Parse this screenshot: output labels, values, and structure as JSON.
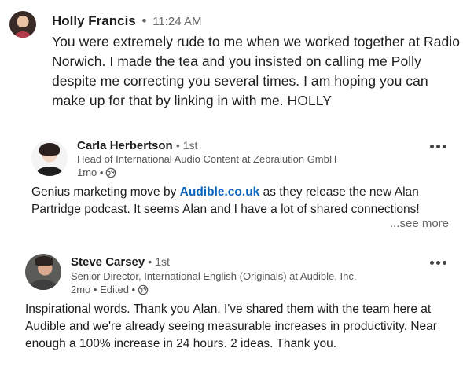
{
  "message": {
    "author": "Holly Francis",
    "separator": "•",
    "time": "11:24 AM",
    "body": "You were extremely rude to me when we worked together at Radio Norwich. I made the tea and you insisted on calling me Polly despite me correcting you several times. I am hoping you can make up for that by linking in with me. HOLLY"
  },
  "comments": [
    {
      "author": "Carla Herbertson",
      "degree": "• 1st",
      "headline": "Head of International Audio Content at Zebralution GmbH",
      "meta": "1mo •",
      "body_before": "Genius marketing move by ",
      "link_text": "Audible.co.uk",
      "body_after": " as they release the new Alan Partridge podcast. It seems Alan and I have a lot of shared connections!",
      "see_more": "...see more",
      "visibility_icon": "globe-icon",
      "menu_icon": "more-icon"
    },
    {
      "author": "Steve Carsey",
      "degree": "• 1st",
      "headline": "Senior Director, International English (Originals) at Audible, Inc.",
      "meta": "2mo • Edited •",
      "body": "Inspirational words. Thank you Alan. I've shared them with the team here at Audible and we're already seeing measurable increases in productivity. Near enough a 100% increase in 24 hours. 2 ideas. Thank you.",
      "visibility_icon": "globe-icon",
      "menu_icon": "more-icon"
    }
  ],
  "colors": {
    "link": "#0a66c2",
    "secondary_text": "#666666",
    "primary_text": "#1d1d1d"
  }
}
